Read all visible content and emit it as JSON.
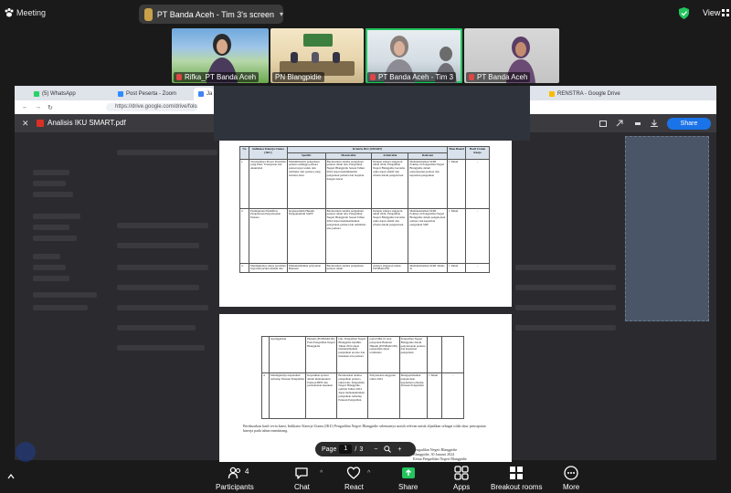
{
  "zoom": {
    "meeting_label": "Meeting",
    "screen_share_pill": "PT Banda Aceh - Tim 3's screen",
    "view_label": "View",
    "participants": [
      {
        "name": "Rifka_PT Banda Aceh",
        "muted": true
      },
      {
        "name": "PN Blangpidie",
        "muted": false
      },
      {
        "name": "PT Banda Aceh - Tim 3",
        "muted": true,
        "active": true
      },
      {
        "name": "PT Banda Aceh",
        "muted": true
      }
    ],
    "toolbar": {
      "participants_label": "Participants",
      "participants_count": "4",
      "chat_label": "Chat",
      "react_label": "React",
      "share_label": "Share",
      "apps_label": "Apps",
      "breakout_label": "Breakout rooms",
      "more_label": "More"
    }
  },
  "browser": {
    "tabs": [
      {
        "label": "(5) WhatsApp",
        "color": "#25d366"
      },
      {
        "label": "Post Peserta - Zoom",
        "color": "#2d8cff"
      },
      {
        "label": "Ja",
        "color": "#4285f4"
      },
      {
        "label": "RENSTRA - Google Drive",
        "color": "#fbbc04"
      }
    ],
    "url": "https://drive.google.com/drive/folde",
    "file_name": "Analisis IKU SMART.pdf",
    "share_label": "Share"
  },
  "pdf": {
    "page_label": "Page",
    "current_page": "1",
    "separator": "/",
    "total_pages": "3",
    "table_headers": [
      "No",
      "Indikator Kinerja Utama (IKU)",
      "Kriteria IKU (SMART)",
      "Specific",
      "Measurable",
      "Achievable",
      "Relevant",
      "Time Bound",
      "Hasil Uraian Renja"
    ],
    "rows_page1": [
      {
        "no": "1.",
        "iku": "Terwujudnya Proses Peradilan yang Pasti, Transparan dan Akuntabel",
        "specific": "Meminimalisir pengaduan perkara sehingga perkara selesai tepat waktu dan terhindar dari perkara yang berlarut-larut",
        "measurable": "Berdasarkan analisa pengaduan perkara tahun lalu, Pengadilan Negeri Blangpidie Sesuai Tahun 2024 dapat meminimalisir pengaduan perkara dan berjalan dengan lancar",
        "achievable": "Dengan adanya anggaran tahun 2024, Pengadilan Negeri Blangpidie bersama sama dapat efektif dan efisien dalam pengelolaan",
        "relevant": "Memaksimalkan SDM Pokmas di Pengadilan Negeri Blangpidie dalam penyelesaian perkara dan kepastian pengaduan",
        "time": "1 Tahun",
        "hasil": "-"
      },
      {
        "no": "2.",
        "iku": "Peningkatan Efektifitas Pengelolaan Penyelesaian Perkara",
        "specific": "Kepuasanlum Hukum Pengajuanlum SOPP",
        "measurable": "Berdasarkan analisa pengaduan perkara tahun lalu, Pengadilan Negeri Blangpidie Sesuai Tahun 2024 dapat memaksimalkan pengaduan perkara dan terhindari atas perkara",
        "achievable": "Dengan adanya anggaran tahun 2024, Pengadilan Negeri Blangpidie bersama sama dapat efektif dan efisien dalam pengelolaan",
        "relevant": "Memaksimalkan SDM Pokmas di Pengadilan Negeri Blangpidie dalam pengelolaan perkara dan kepastian pengaduan SDP",
        "time": "1 Tahun",
        "hasil": "-"
      },
      {
        "no": "3.",
        "iku": "Meningkatnya akses peradilan bagi masyarakat miskin dan",
        "specific": "Memaksimalkan pelayanan Bantuan",
        "measurable": "Berdasarkan analisa pengaduan perkara tahun",
        "achievable": "Adanya anggaran untuk POSBAKUM",
        "relevant": "Memaksimalkan SDM Teknis di",
        "time": "1 Tahun",
        "hasil": "-"
      }
    ],
    "rows_page2": [
      {
        "no": "",
        "iku": "terpinggirkan",
        "specific": "Hukum (POSBAKUM) Pada Pengadilan Negeri Blangpidie",
        "measurable": "lalu, Pengadilan Negeri Blangpidie Optimis Tahun 2024 dapat memaksimalkan pengaduan prodeo dan menekan atas perkara",
        "achievable": "pada DIPA 01 atau pelayanan Bantuan Hukum (POSBAKUM) pengadilan dapat terlaksana",
        "relevant": "Pengadilan Negeri Blangpidie dalam penyelesaian perkara dan kepastian pengaduan",
        "time": "",
        "hasil": ""
      },
      {
        "no": "4.",
        "iku": "Meningkatnya kepatuhan terhadap Putusan Pengadilan",
        "specific": "Kepatuhan apratur dalam memaksakan Putusan BHT dan permohonan eksekusi",
        "measurable": "Berdasarkan analisa pengaduan perkara tahun lalu, Pengadilan Negeri Blangpidie, optimis Tahun 2024 dapat memaksimalkan pengaduan terhadap Putusan Pengadilan",
        "achievable": "Penyesuaian anggaran tahun 2024",
        "relevant": "Mengoptimalkan pengelolaan kepatuhan terhadap Putusan Pengadilan",
        "time": "1 Tahun",
        "hasil": "-"
      }
    ],
    "closing_paragraph": "Berdasarkan hasil reviu kami, Indikator Kinerja Utama (IKU) Pengadilan Negeri Blangpidie sebenarnya masih relevan untuk dijadikan sebagai tolak ukur pencapaian kinerja pada tahun mendatang.",
    "signature_place": "Blangpidie, 30 Januari 2024",
    "signature_title": "Ketua Pengadilan Negeri Blangpidie",
    "signature_org": "Pengadilan Negeri Blangpidie"
  }
}
